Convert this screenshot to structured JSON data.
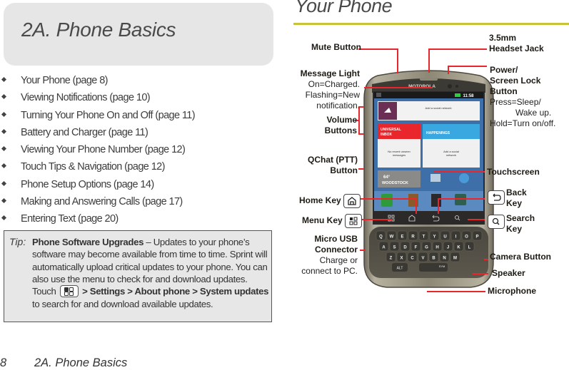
{
  "chapter": {
    "title": "2A.  Phone Basics"
  },
  "toc": {
    "items": [
      "Your Phone (page 8)",
      "Viewing Notifications (page 10)",
      "Turning Your Phone On and Off (page 11)",
      "Battery and Charger (page 11)",
      "Viewing Your Phone Number (page 12)",
      "Touch Tips & Navigation (page 12)",
      "Phone Setup Options (page 14)",
      "Making and Answering Calls (page 17)",
      "Entering Text (page 20)"
    ]
  },
  "tip": {
    "label": "Tip:",
    "heading": "Phone Software Upgrades",
    "text1": " – Updates to your phone’s software may become available from time to time. Sprint will automatically upload critical updates to your phone. You can also use the menu to check for and download updates. Touch ",
    "path1": " > Settings > About phone > System updates",
    "text2": " to search for and download available updates."
  },
  "footer": {
    "page_number": "8",
    "section": "2A. Phone Basics"
  },
  "section": {
    "title": "Your Phone"
  },
  "callouts": {
    "mute": "Mute Button",
    "headset_line1": "3.5mm",
    "headset_line2": "Headset Jack",
    "message_light": "Message Light",
    "message_light_desc1": "On=Charged.",
    "message_light_desc2": "Flashing=New",
    "message_light_desc3": "notification.",
    "power_line1": "Power/",
    "power_line2": "Screen Lock",
    "power_line3": "Button",
    "power_desc1": "Press=Sleep/",
    "power_desc2": "Wake up.",
    "power_desc3": "Hold=Turn on/off.",
    "volume_line1": "Volume",
    "volume_line2": "Buttons",
    "qchat_line1": "QChat (PTT)",
    "qchat_line2": "Button",
    "touchscreen": "Touchscreen",
    "home_key": "Home Key",
    "back_line1": "Back",
    "back_line2": "Key",
    "menu_key": "Menu Key",
    "search_line1": "Search",
    "search_line2": "Key",
    "usb_line1": "Micro USB",
    "usb_line2": "Connector",
    "usb_desc1": "Charge or",
    "usb_desc2": "connect to PC.",
    "camera": "Camera Button",
    "speaker": "Speaker",
    "microphone": "Microphone"
  },
  "phone_screen": {
    "brand": "MOTOROLA",
    "status_time": "11:58",
    "widget_social": "Add a social network",
    "universal_inbox_line1": "UNIVERSAL",
    "universal_inbox_line2": "INBOX",
    "happenings": "HAPPENINGS",
    "inbox_empty_line1": "No recent unseen",
    "inbox_empty_line2": "messages",
    "happenings_empty_line1": "Add a social",
    "happenings_empty_line2": "network",
    "weather_temp": "64°",
    "weather_city": "WOODSTOCK",
    "keyboard_rows": [
      [
        "Q",
        "W",
        "E",
        "R",
        "T",
        "Y",
        "U",
        "I",
        "O",
        "P"
      ],
      [
        "A",
        "S",
        "D",
        "F",
        "G",
        "H",
        "J",
        "K",
        "L"
      ],
      [
        "Z",
        "X",
        "C",
        "V",
        "B",
        "N",
        "M"
      ]
    ],
    "alt_key": "ALT",
    "sym_key": "SYM"
  },
  "colors": {
    "callout_line": "#e8262c",
    "section_rule": "#c9c33a",
    "universal_inbox": "#e8262c",
    "happenings": "#3aa8e0",
    "social_widget_icon_bg": "#6b2f55"
  }
}
